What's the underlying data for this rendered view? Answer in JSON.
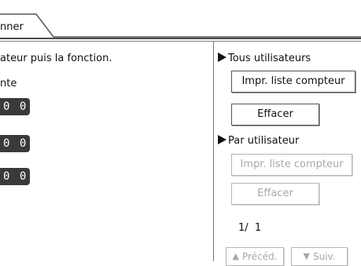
{
  "tab": {
    "label": "nner"
  },
  "left": {
    "instruction": "ateur puis la fonction.",
    "subheading": "nte",
    "counters": [
      "0 0",
      "0 0",
      "0 0"
    ]
  },
  "right": {
    "all_users": {
      "heading": "Tous utilisateurs",
      "print_button": "Impr. liste compteur",
      "clear_button": "Effacer"
    },
    "per_user": {
      "heading": "Par utilisateur",
      "print_button": "Impr. liste compteur",
      "clear_button": "Effacer"
    },
    "page_indicator": "1/  1",
    "prev_button": "Précéd.",
    "next_button": "Suiv."
  },
  "icons": {
    "section_marker": "right-triangle-icon",
    "prev": "up-triangle-icon",
    "next": "down-triangle-icon"
  }
}
